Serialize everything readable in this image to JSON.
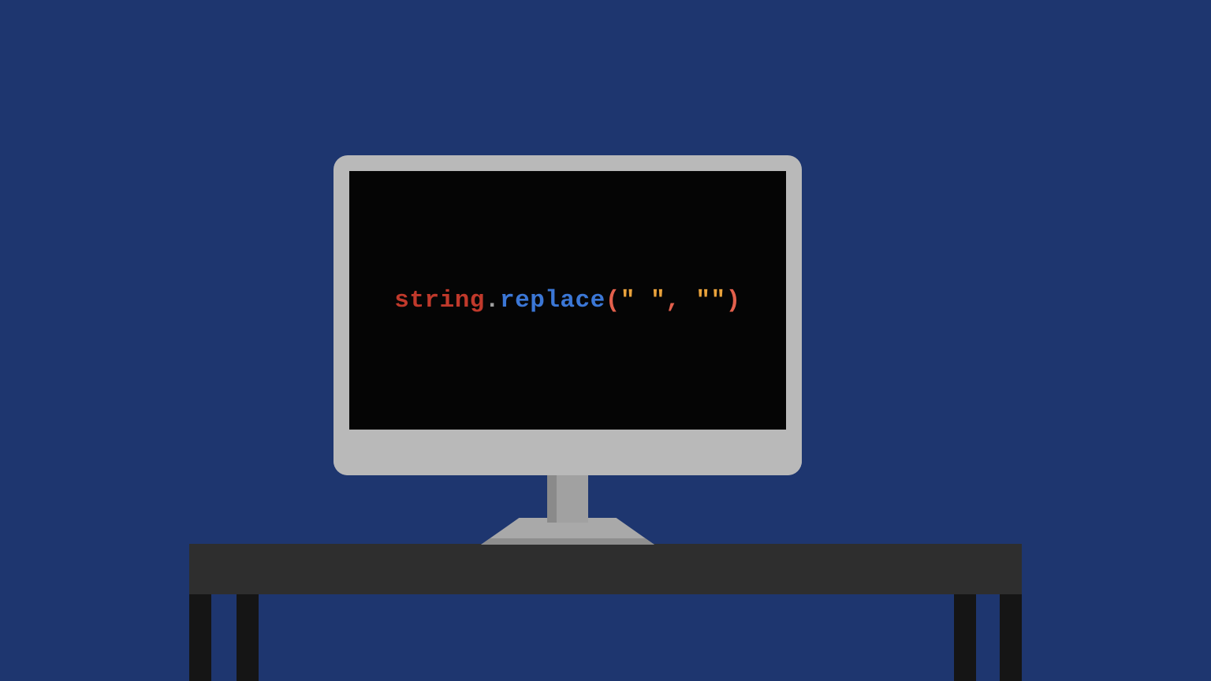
{
  "code": {
    "variable": "string",
    "dot": ".",
    "function": "replace",
    "paren_open": "(",
    "arg1": "\" \"",
    "comma": ", ",
    "arg2": "\"\"",
    "paren_close": ")"
  },
  "colors": {
    "background": "#1e366f",
    "monitor_bezel": "#b9b9b9",
    "screen": "#050505",
    "desk": "#2e2e2e",
    "variable": "#c0392b",
    "function": "#3b77d6",
    "paren": "#e3604c",
    "string": "#e9a23b",
    "dot": "#9e9e9e"
  }
}
